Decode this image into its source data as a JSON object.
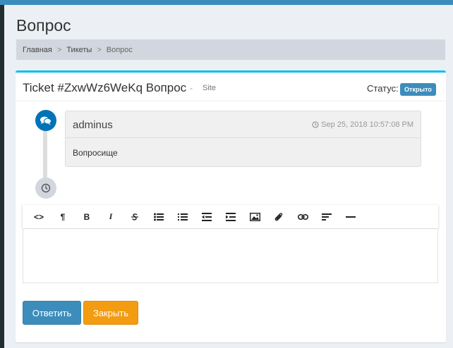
{
  "header": {
    "title": "Вопрос"
  },
  "breadcrumb": {
    "items": [
      "Главная",
      "Тикеты",
      "Вопрос"
    ],
    "separator": ">"
  },
  "ticket": {
    "title": "Ticket #ZxwWz6WeKq Вопрос",
    "dash": "-",
    "site": "Site",
    "status_label": "Статус:",
    "status_value": "Открыто"
  },
  "message": {
    "author": "adminus",
    "time": "Sep 25, 2018 10:57:08 PM",
    "body": "Вопросище"
  },
  "editor": {
    "toolbar_icons": [
      "code-icon",
      "paragraph-icon",
      "bold-icon",
      "italic-icon",
      "strikethrough-icon",
      "bullet-list-icon",
      "numbered-list-icon",
      "outdent-icon",
      "indent-icon",
      "image-icon",
      "attach-icon",
      "link-icon",
      "align-left-icon",
      "horizontal-rule-icon"
    ],
    "code_glyph": "<>",
    "paragraph_glyph": "¶",
    "bold_glyph": "B",
    "italic_glyph": "I",
    "value": ""
  },
  "actions": {
    "reply_label": "Ответить",
    "close_label": "Закрыть"
  },
  "colors": {
    "accent": "#3c8dbc",
    "box_top_border": "#00c0ef",
    "close_button": "#f39c12",
    "timeline_chat": "#0073b7"
  }
}
